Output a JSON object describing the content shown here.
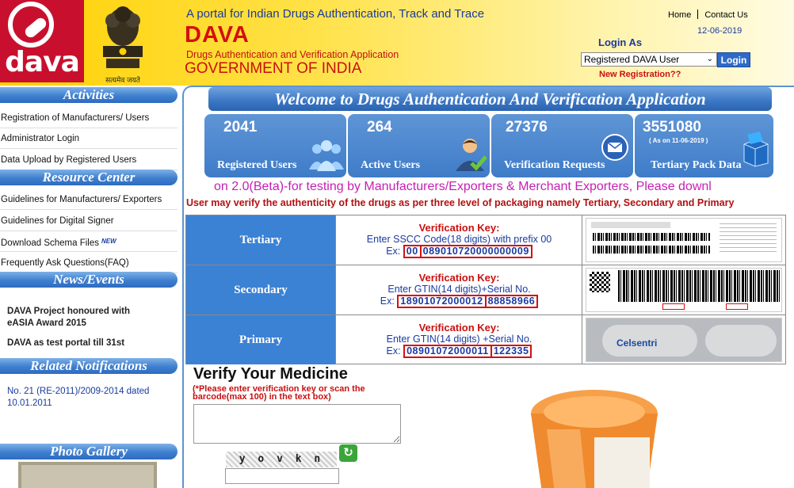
{
  "header": {
    "logo_text": "dava",
    "emblem_motto": "सत्यमेव जयते",
    "tagline": "A portal for Indian Drugs Authentication, Track and Trace",
    "brand": "DAVA",
    "brand_sub": "Drugs Authentication and Verification Application",
    "gov": "GOVERNMENT OF INDIA",
    "links": [
      "Home",
      "Contact Us"
    ],
    "date": "12-06-2019",
    "login_as": "Login As",
    "login_select": "Registered DAVA User",
    "login_button": "Login",
    "new_registration": "New Registration??"
  },
  "sidebar": {
    "activities_title": "Activities",
    "activities": [
      "Registration of Manufacturers/ Users",
      "Administrator Login",
      "Data Upload by Registered Users"
    ],
    "resource_title": "Resource Center",
    "resources": [
      "Guidelines for Manufacturers/ Exporters",
      "Guidelines for Digital Signer",
      "Download Schema Files",
      "Frequently Ask Questions(FAQ)"
    ],
    "new_badge": "NEW",
    "news_title": "News/Events",
    "news": [
      "DAVA Project honoured with eASIA Award 2015",
      "DAVA as test portal till 31st"
    ],
    "notifications_title": "Related Notifications",
    "notification_text": "No. 21 (RE-2011)/2009-2014 dated 10.01.2011",
    "gallery_title": "Photo Gallery"
  },
  "main": {
    "welcome": "Welcome to Drugs Authentication And Verification Application",
    "stats": [
      {
        "value": "2041",
        "label": "Registered Users",
        "sub": ""
      },
      {
        "value": "264",
        "label": "Active Users",
        "sub": ""
      },
      {
        "value": "27376",
        "label": "Verification Requests",
        "sub": ""
      },
      {
        "value": "3551080",
        "label": "Tertiary Pack Data",
        "sub": "( As on 11-06-2019 )"
      }
    ],
    "marquee": "on 2.0(Beta)-for testing by Manufacturers/Exporters & Merchant Exporters, Please downl",
    "instruction": "User may verify the authenticity of the drugs as per three level of packaging namely Tertiary, Secondary and Primary",
    "levels": [
      {
        "name": "Tertiary",
        "key_title": "Verification Key:",
        "desc": "Enter SSCC Code(18 digits) with prefix 00",
        "ex_label": "Ex:",
        "ex_part1": "00",
        "ex_part2": "089010720000000009"
      },
      {
        "name": "Secondary",
        "key_title": "Verification Key:",
        "desc": "Enter GTIN(14 digits)+Serial No.",
        "ex_label": "Ex:",
        "ex_part1": "18901072000012",
        "ex_part2": "88858966"
      },
      {
        "name": "Primary",
        "key_title": "Verification Key:",
        "desc": "Enter GTIN(14 digits) +Serial No.",
        "ex_label": "Ex:",
        "ex_part1": "08901072000011",
        "ex_part2": "122335"
      }
    ],
    "verify_title": "Verify Your Medicine",
    "verify_note": "(*Please enter verification key or scan the barcode(max 100) in the text box)",
    "captcha": "y o v k n",
    "pack_brand": "Celsentri"
  }
}
